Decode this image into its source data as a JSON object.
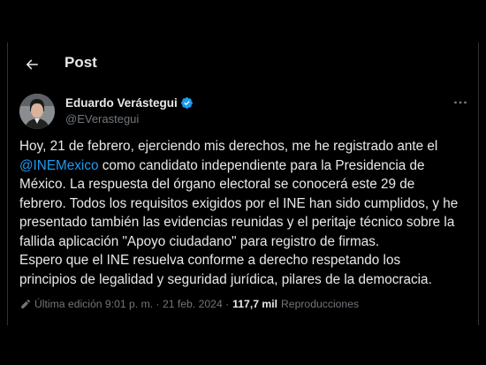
{
  "header": {
    "title": "Post"
  },
  "author": {
    "name": "Eduardo Verástegui",
    "handle": "@EVerastegui"
  },
  "tweet": {
    "text_before": "Hoy, 21 de febrero, ejerciendo mis derechos, me he registrado ante el\n",
    "mention": "@INEMexico",
    "text_after": " como candidato independiente para la Presidencia de\nMéxico. La respuesta del órgano electoral se conocerá este 29 de\nfebrero. Todos los requisitos exigidos por el INE han sido cumplidos, y he\npresentado también las evidencias reunidas y el peritaje técnico sobre la\nfallida aplicación \"Apoyo ciudadano\" para registro de firmas.\nEspero que el INE resuelva conforme a derecho respetando los\nprincipios de legalidad y seguridad jurídica, pilares de la democracia."
  },
  "meta": {
    "edited": "Última edición 9:01 p. m. · 21 feb. 2024 · ",
    "views": "117,7 mil",
    "views_label": "Reproducciones"
  },
  "icons": {
    "back": "arrow-left-icon",
    "verified": "verified-badge-icon",
    "more": "more-horizontal-icon",
    "edit": "pencil-icon"
  },
  "colors": {
    "background": "#000000",
    "text": "#e7e9ea",
    "muted": "#71767b",
    "accent": "#1d9bf0"
  }
}
